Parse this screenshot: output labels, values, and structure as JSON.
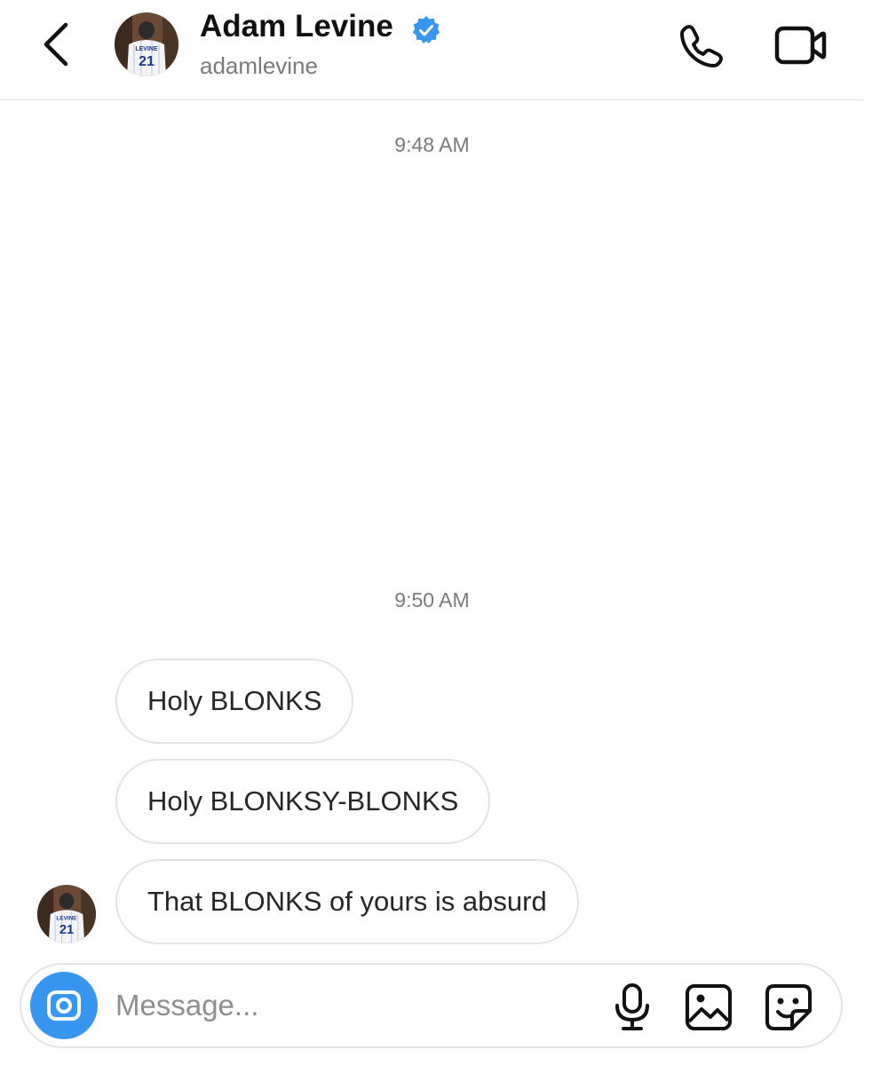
{
  "header": {
    "name": "Adam Levine",
    "handle": "adamlevine",
    "verified": true,
    "avatar_jersey_name": "LEVINE",
    "avatar_jersey_number": "21",
    "icons": {
      "back": "chevron-left-icon",
      "verified": "verified-badge-icon",
      "call": "phone-icon",
      "video": "video-camera-icon"
    }
  },
  "thread": {
    "timestamps": [
      "9:48 AM",
      "9:50 AM"
    ],
    "messages": [
      {
        "text": "Holy BLONKS"
      },
      {
        "text": "Holy BLONKSY-BLONKS"
      },
      {
        "text": "That BLONKS of yours is absurd"
      }
    ]
  },
  "composer": {
    "placeholder": "Message...",
    "value": "",
    "icons": {
      "camera": "camera-icon",
      "mic": "microphone-icon",
      "gallery": "image-icon",
      "sticker": "sticker-icon"
    }
  },
  "colors": {
    "accent": "#3797f0",
    "bubble_border": "#e4e4e4",
    "secondary_text": "#7a7a7a"
  }
}
